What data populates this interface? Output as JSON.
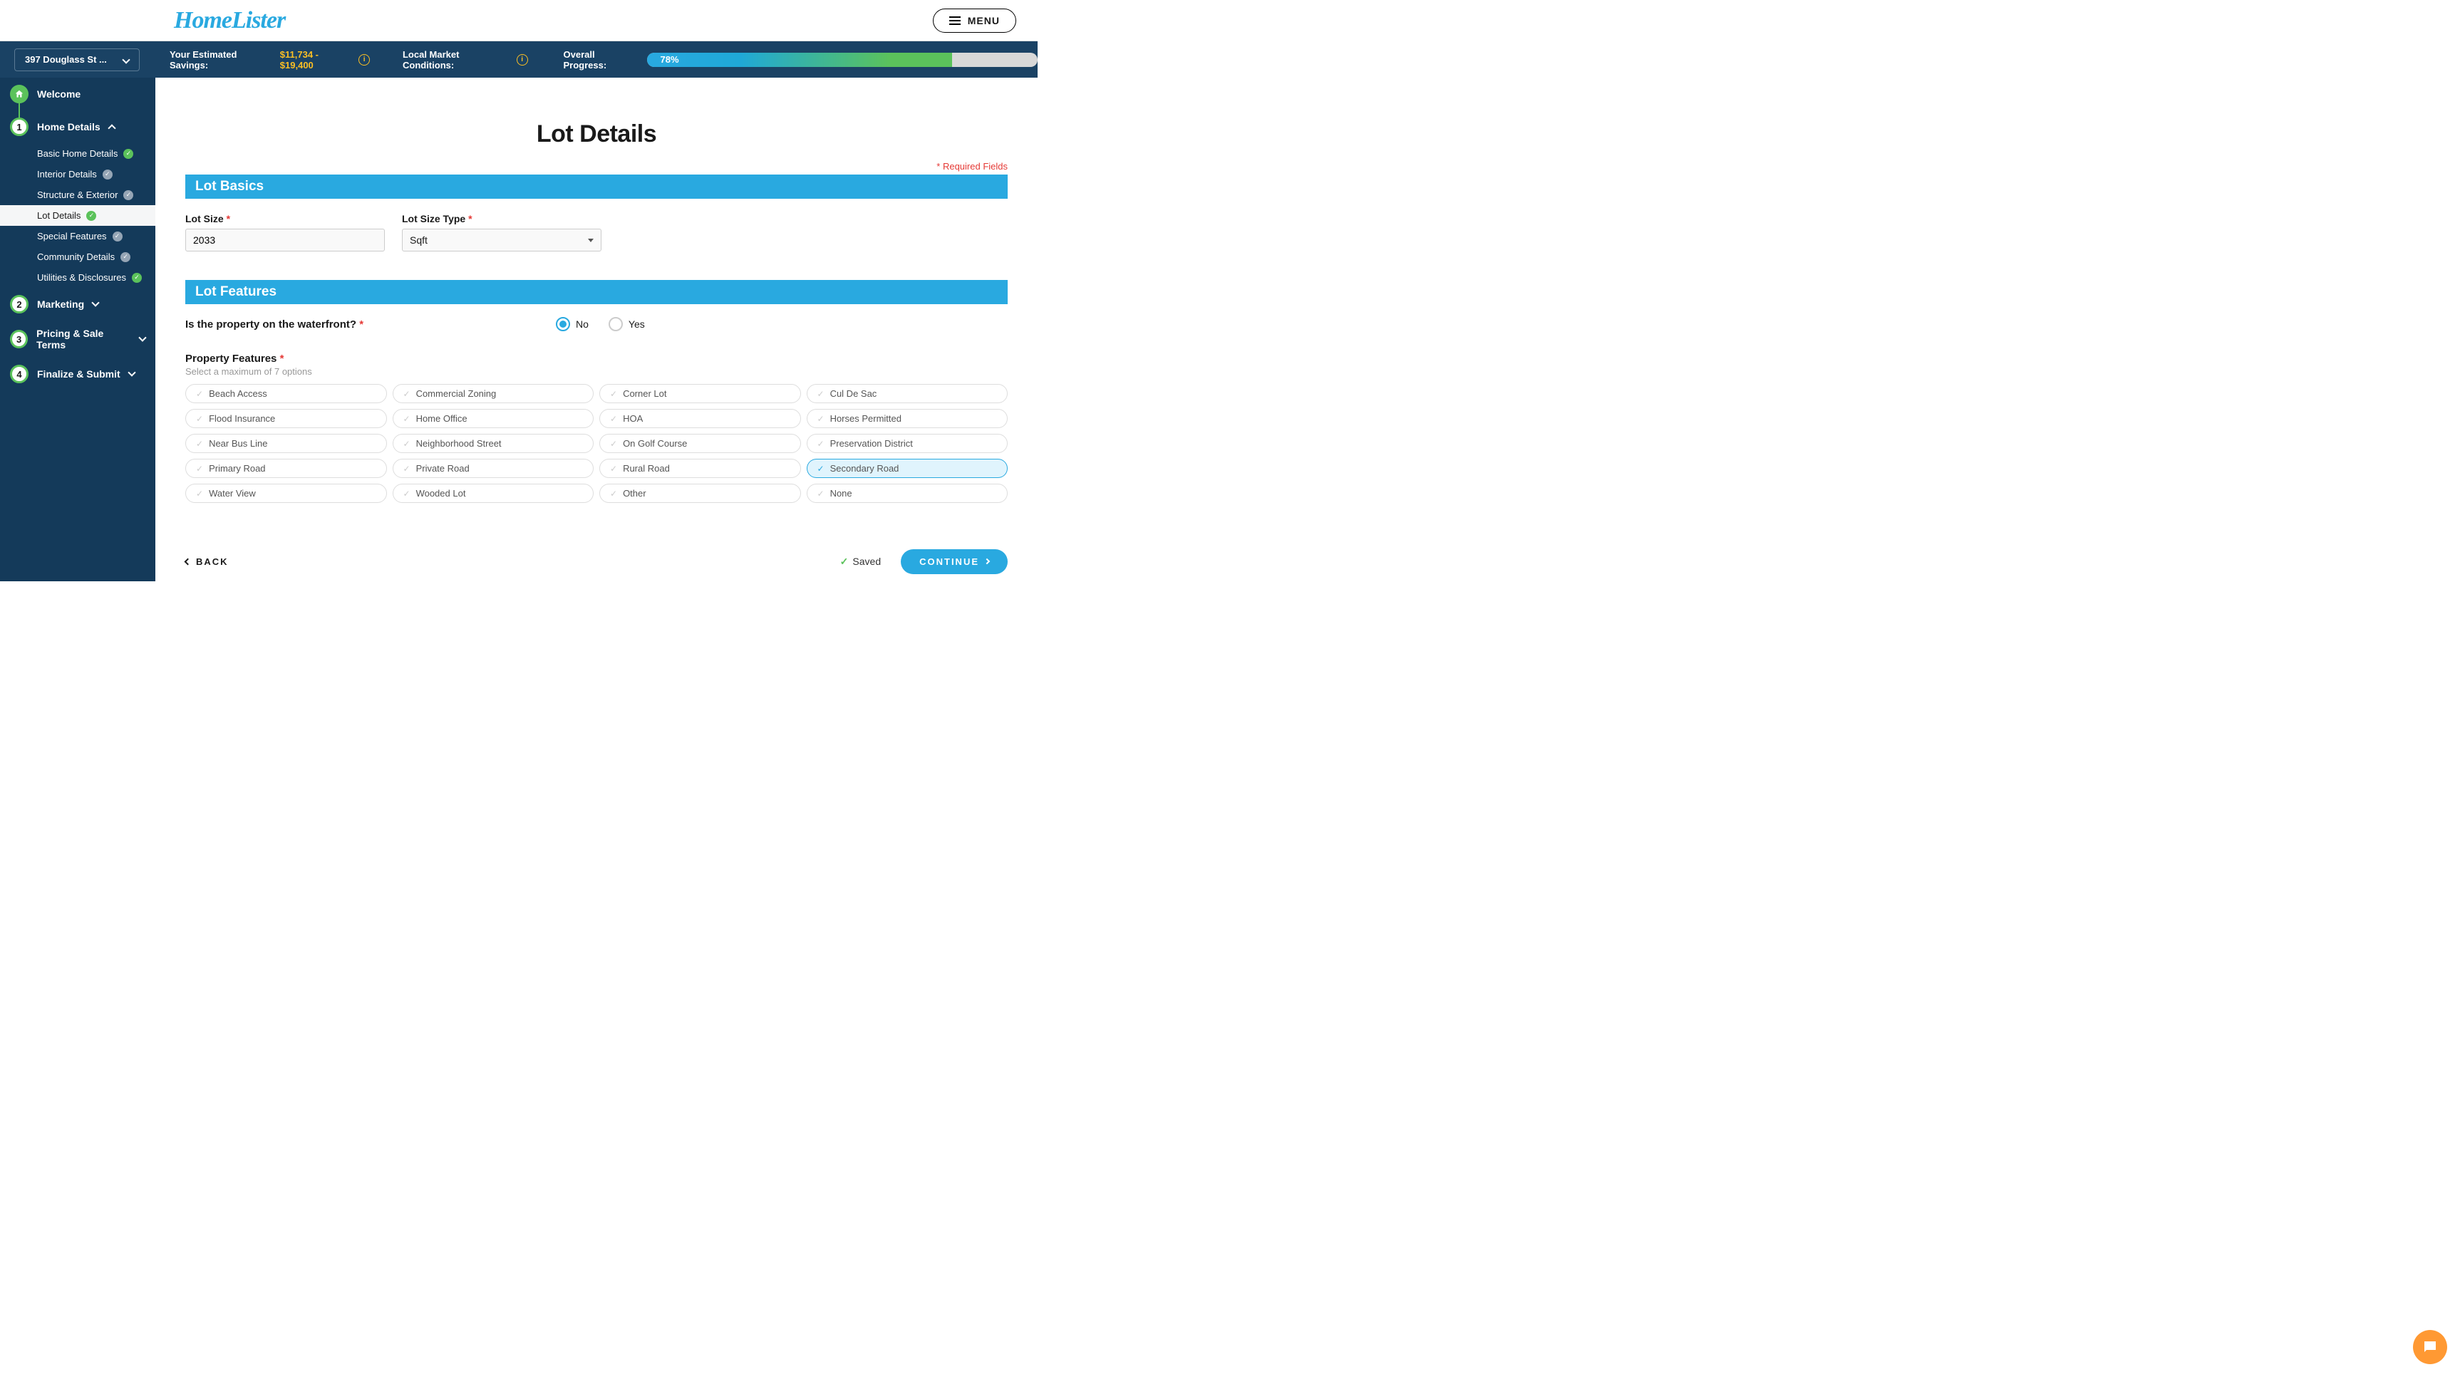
{
  "logo_text": "HomeLister",
  "menu_label": "MENU",
  "address": "397 Douglass St ...",
  "savings_label": "Your Estimated Savings:",
  "savings_value": "$11,734 - $19,400",
  "local_market_label": "Local Market Conditions:",
  "progress_label": "Overall Progress:",
  "progress_pct": "78%",
  "progress_width": "78%",
  "sidebar": {
    "welcome": "Welcome",
    "home_details": "Home Details",
    "subs": [
      {
        "label": "Basic Home Details",
        "status": "green"
      },
      {
        "label": "Interior Details",
        "status": "gray"
      },
      {
        "label": "Structure & Exterior",
        "status": "gray"
      },
      {
        "label": "Lot Details",
        "status": "green"
      },
      {
        "label": "Special Features",
        "status": "gray"
      },
      {
        "label": "Community Details",
        "status": "gray"
      },
      {
        "label": "Utilities & Disclosures",
        "status": "green"
      }
    ],
    "marketing": "Marketing",
    "pricing": "Pricing & Sale Terms",
    "finalize": "Finalize & Submit",
    "step2": "2",
    "step3": "3",
    "step4": "4",
    "step1": "1"
  },
  "page_title": "Lot Details",
  "required_note": "* Required Fields",
  "section_basics": "Lot Basics",
  "lot_size_label": "Lot Size",
  "lot_size_value": "2033",
  "lot_size_type_label": "Lot Size Type",
  "lot_size_type_value": "Sqft",
  "section_features": "Lot Features",
  "waterfront_q": "Is the property on the waterfront?",
  "opt_no": "No",
  "opt_yes": "Yes",
  "feat_title": "Property Features",
  "feat_sub": "Select a maximum of 7 options",
  "features": [
    {
      "label": "Beach Access",
      "sel": false
    },
    {
      "label": "Commercial Zoning",
      "sel": false
    },
    {
      "label": "Corner Lot",
      "sel": false
    },
    {
      "label": "Cul De Sac",
      "sel": false
    },
    {
      "label": "Flood Insurance",
      "sel": false
    },
    {
      "label": "Home Office",
      "sel": false
    },
    {
      "label": "HOA",
      "sel": false
    },
    {
      "label": "Horses Permitted",
      "sel": false
    },
    {
      "label": "Near Bus Line",
      "sel": false
    },
    {
      "label": "Neighborhood Street",
      "sel": false
    },
    {
      "label": "On Golf Course",
      "sel": false
    },
    {
      "label": "Preservation District",
      "sel": false
    },
    {
      "label": "Primary Road",
      "sel": false
    },
    {
      "label": "Private Road",
      "sel": false
    },
    {
      "label": "Rural Road",
      "sel": false
    },
    {
      "label": "Secondary Road",
      "sel": true
    },
    {
      "label": "Water View",
      "sel": false
    },
    {
      "label": "Wooded Lot",
      "sel": false
    },
    {
      "label": "Other",
      "sel": false
    },
    {
      "label": "None",
      "sel": false
    }
  ],
  "back_label": "BACK",
  "saved_label": "Saved",
  "continue_label": "CONTINUE"
}
